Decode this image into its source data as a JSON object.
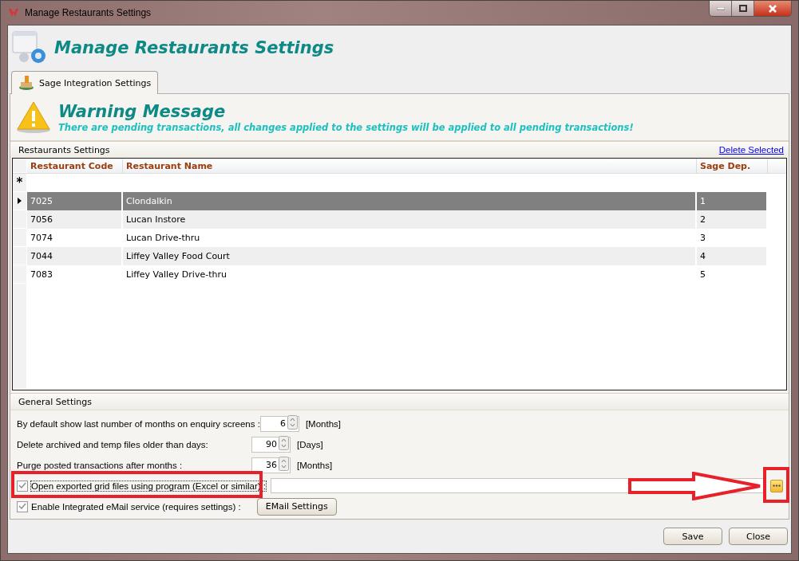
{
  "window": {
    "title": "Manage Restaurants Settings"
  },
  "header": {
    "title": "Manage Restaurants Settings"
  },
  "tabs": [
    {
      "label": "Sage Integration Settings",
      "selected": true
    }
  ],
  "warning": {
    "title": "Warning Message",
    "message": "There are pending transactions, all changes applied to the settings will be applied to all pending transactions!"
  },
  "restaurants": {
    "title": "Restaurants Settings",
    "delete_link": "Delete Selected",
    "new_row_marker": "*",
    "columns": [
      "Restaurant Code",
      "Restaurant Name",
      "Sage Dep."
    ],
    "rows": [
      {
        "code": "7025",
        "name": "Clondalkin",
        "dep": "1",
        "selected": true
      },
      {
        "code": "7056",
        "name": "Lucan Instore",
        "dep": "2",
        "selected": false
      },
      {
        "code": "7074",
        "name": "Lucan Drive-thru",
        "dep": "3",
        "selected": false
      },
      {
        "code": "7044",
        "name": "Liffey Valley Food Court",
        "dep": "4",
        "selected": false
      },
      {
        "code": "7083",
        "name": "Liffey Valley Drive-thru",
        "dep": "5",
        "selected": false
      }
    ]
  },
  "general": {
    "title": "General Settings",
    "settings": [
      {
        "kind": "spinner",
        "label": "By default show last number of months on enquiry screens :",
        "value": "6",
        "unit": "[Months]"
      },
      {
        "kind": "spinner",
        "label": "Delete archived and temp files older than days:",
        "value": "90",
        "unit": "[Days]"
      },
      {
        "kind": "spinner",
        "label": "Purge posted transactions after months :",
        "value": "36",
        "unit": "[Months]"
      },
      {
        "kind": "path",
        "label": "Open exported grid files using program (Excel or similar) :",
        "checked": true
      },
      {
        "kind": "button",
        "label": "Enable Integrated eMail service (requires settings) :",
        "checked": true,
        "button": "EMail Settings"
      }
    ]
  },
  "buttons": [
    "Save",
    "Close"
  ]
}
